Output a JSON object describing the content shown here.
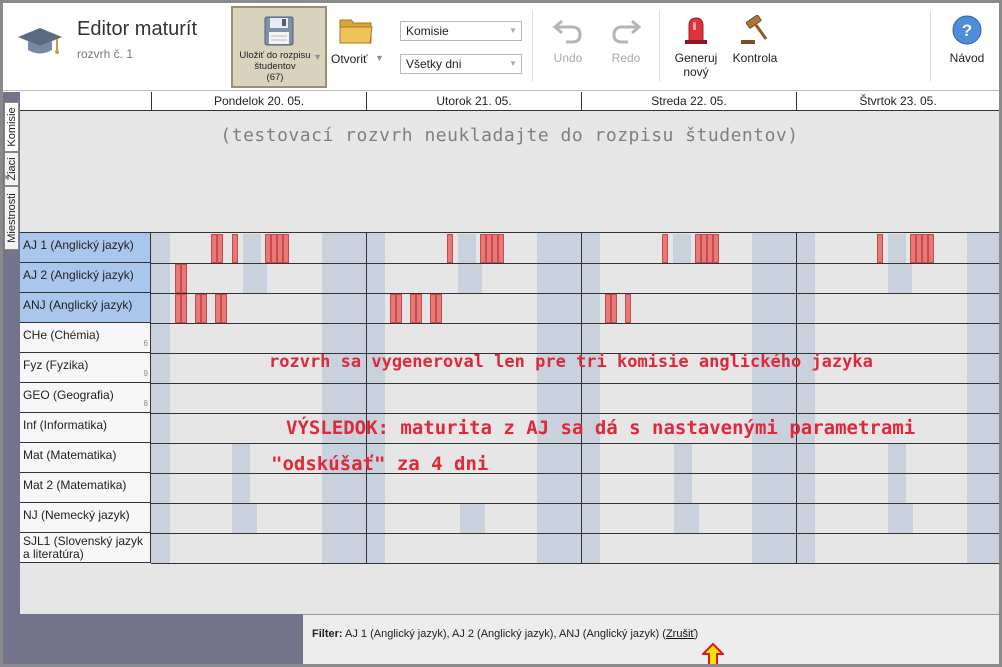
{
  "app": {
    "title": "Editor maturít",
    "subtitle": "rozvrh č. 1"
  },
  "toolbar": {
    "save_label": "Uložiť do rozpisu študentov",
    "save_count": "(67)",
    "open_label": "Otvoriť",
    "commission_select": "Komisie",
    "days_select": "Všetky dni",
    "undo_label": "Undo",
    "redo_label": "Redo",
    "generate_label_1": "Generuj",
    "generate_label_2": "nový",
    "check_label": "Kontrola",
    "help_label": "Návod"
  },
  "side_tabs": [
    "Komisie",
    "Žiaci",
    "Miestnosti"
  ],
  "days": [
    "Pondelok 20. 05.",
    "Utorok 21. 05.",
    "Streda 22. 05.",
    "Štvrtok 23. 05."
  ],
  "notice": "(testovací rozvrh neukladajte do rozpisu študentov)",
  "rows": [
    {
      "label": "AJ 1 (Anglický jazyk)",
      "count": ""
    },
    {
      "label": "AJ 2 (Anglický jazyk)",
      "count": ""
    },
    {
      "label": "ANJ (Anglický jazyk)",
      "count": ""
    },
    {
      "label": "CHe (Chémia)",
      "count": "6"
    },
    {
      "label": "Fyz (Fyzika)",
      "count": "9"
    },
    {
      "label": "GEO (Geografia)",
      "count": "8"
    },
    {
      "label": "Inf (Informatika)",
      "count": ""
    },
    {
      "label": "Mat (Matematika)",
      "count": ""
    },
    {
      "label": "Mat 2 (Matematika)",
      "count": ""
    },
    {
      "label": "NJ (Nemecký jazyk)",
      "count": ""
    },
    {
      "label": "SJL1 (Slovenský jazyk a literatúra)",
      "count": ""
    }
  ],
  "annotations": {
    "line1": "rozvrh sa vygeneroval len pre tri komisie anglického jazyka",
    "line2": "VÝSLEDOK:  maturita z AJ sa dá s nastavenými parametrami",
    "line3": "\"odskúšať\" za 4 dni"
  },
  "footer": {
    "filter_label": "Filter:",
    "filter_value": "AJ 1 (Anglický jazyk), AJ 2 (Anglický jazyk), ANJ (Anglický jazyk)",
    "cancel_label": "Zrušiť"
  },
  "colors": {
    "exam_block": "#e87878",
    "selected_row": "#a9c6ec",
    "sidebar": "#73738c",
    "annotation": "#e0283a",
    "save_button": "#d9d2bd"
  }
}
